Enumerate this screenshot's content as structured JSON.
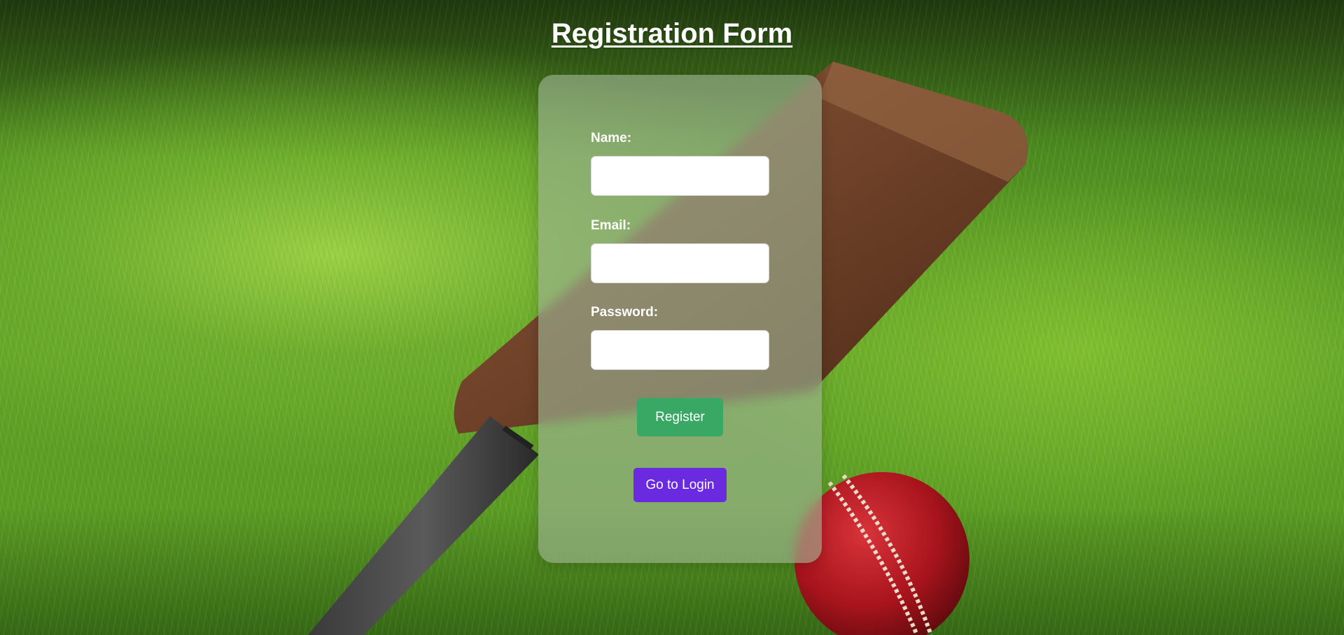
{
  "page": {
    "title": "Registration Form"
  },
  "form": {
    "fields": [
      {
        "label": "Name:",
        "value": "",
        "placeholder": "",
        "type": "text"
      },
      {
        "label": "Email:",
        "value": "",
        "placeholder": "",
        "type": "email"
      },
      {
        "label": "Password:",
        "value": "",
        "placeholder": "",
        "type": "password"
      }
    ],
    "register_label": "Register",
    "login_label": "Go to Login"
  },
  "colors": {
    "register_button": "#3aa865",
    "login_button": "#6a2be0",
    "card_background": "rgba(160,180,150,0.62)",
    "title_text": "#ffffff"
  },
  "background": {
    "description_icon": "cricket-bat-and-ball-on-grass"
  }
}
